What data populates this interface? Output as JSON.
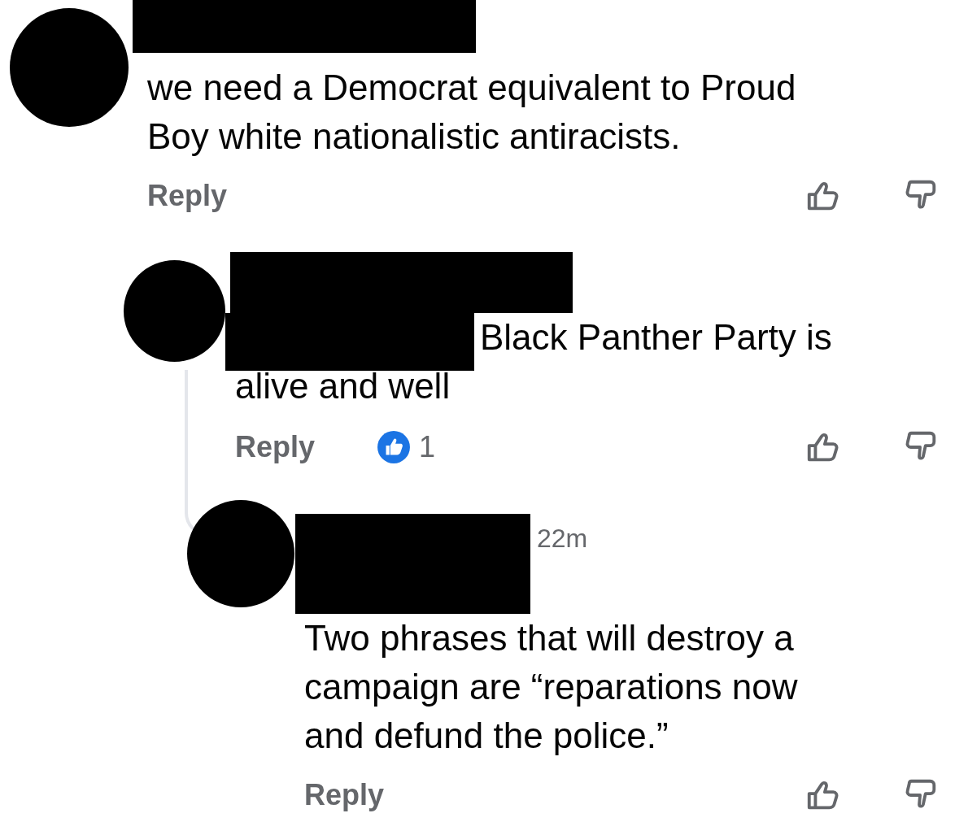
{
  "comments": [
    {
      "name_redacted": true,
      "text": "we need a Democrat equivalent to Proud Boy white nationalistic antiracists.",
      "reply": "Reply",
      "children": [
        {
          "name_redacted": true,
          "text": "Black Panther Party is alive and well",
          "reply": "Reply",
          "reactions": {
            "count": "1"
          },
          "children": [
            {
              "name_redacted": true,
              "time": "22m",
              "text": "Two phrases that will destroy a campaign are “reparations now and defund the police.”",
              "reply": "Reply"
            }
          ]
        }
      ]
    }
  ]
}
